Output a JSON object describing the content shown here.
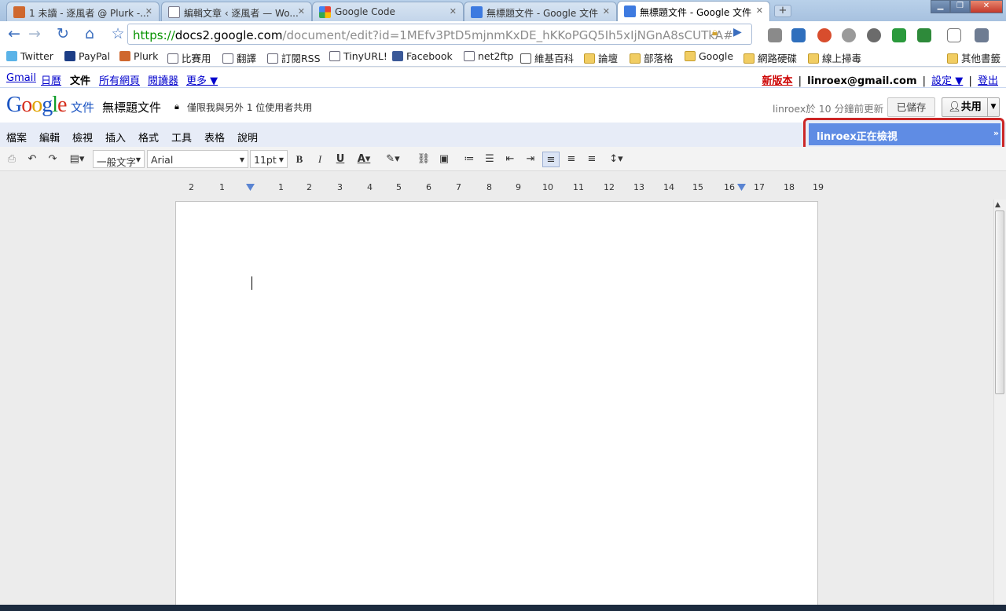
{
  "browser": {
    "tabs": [
      {
        "title": "1 未讀 - 逐風者 @ Plurk -...",
        "icon": "plurk-icon"
      },
      {
        "title": "編輯文章 ‹ 逐風者 — Wo...",
        "icon": "page-icon"
      },
      {
        "title": "Google Code",
        "icon": "google-icon"
      },
      {
        "title": "無標題文件 - Google 文件",
        "icon": "docs-icon"
      },
      {
        "title": "無標題文件 - Google 文件",
        "icon": "docs-icon"
      }
    ],
    "active_tab_index": 4,
    "new_tab": "+",
    "url_scheme": "https://",
    "url_host": "docs2.google.com",
    "url_path": "/document/edit?id=1MEfv3PtD5mjnmKxDE_hKKoPGQ5Ih5xIjNGnA8sCUTkA#",
    "bookmarks": [
      {
        "label": "Twitter",
        "icon": "twitter-icon"
      },
      {
        "label": "PayPal",
        "icon": "paypal-icon"
      },
      {
        "label": "Plurk",
        "icon": "plurk-icon"
      },
      {
        "label": "比賽用",
        "icon": "page-icon"
      },
      {
        "label": "翻譯",
        "icon": "page-icon"
      },
      {
        "label": "訂閱RSS",
        "icon": "page-icon"
      },
      {
        "label": "TinyURL!",
        "icon": "page-icon"
      },
      {
        "label": "Facebook",
        "icon": "facebook-icon"
      },
      {
        "label": "net2ftp",
        "icon": "ftp-icon"
      },
      {
        "label": "維基百科",
        "icon": "wikipedia-icon"
      },
      {
        "label": "論壇",
        "icon": "folder-icon"
      },
      {
        "label": "部落格",
        "icon": "folder-icon"
      },
      {
        "label": "Google",
        "icon": "folder-icon"
      },
      {
        "label": "網路硬碟",
        "icon": "folder-icon"
      },
      {
        "label": "線上掃毒",
        "icon": "folder-icon"
      }
    ],
    "other_bookmarks": "其他書籤"
  },
  "gbar": {
    "links": [
      "Gmail",
      "日曆",
      "文件",
      "所有網頁",
      "閱讀器",
      "更多 ▼"
    ],
    "new_version": "新版本",
    "email": "linroex@gmail.com",
    "settings": "設定 ▼",
    "signout": "登出",
    "sep": "|"
  },
  "doc": {
    "logo_docs": "文件",
    "title": "無標題文件",
    "sharing_status": "僅限我與另外 1 位使用者共用",
    "last_edit": "linroex於 10 分鐘前更新",
    "saved_label": "已儲存",
    "share_label": "共用"
  },
  "menu": [
    "檔案",
    "編輯",
    "檢視",
    "插入",
    "格式",
    "工具",
    "表格",
    "說明"
  ],
  "viewer": {
    "label": "linroex正在檢視"
  },
  "toolbar": {
    "style": "一般文字",
    "font": "Arial",
    "size": "11pt",
    "bold": "B",
    "italic": "I",
    "underline": "U",
    "text_color": "A"
  },
  "ruler": {
    "ticks": [
      "2",
      "1",
      "1",
      "2",
      "3",
      "4",
      "5",
      "6",
      "7",
      "8",
      "9",
      "10",
      "11",
      "12",
      "13",
      "14",
      "15",
      "16",
      "17",
      "18",
      "19"
    ]
  }
}
